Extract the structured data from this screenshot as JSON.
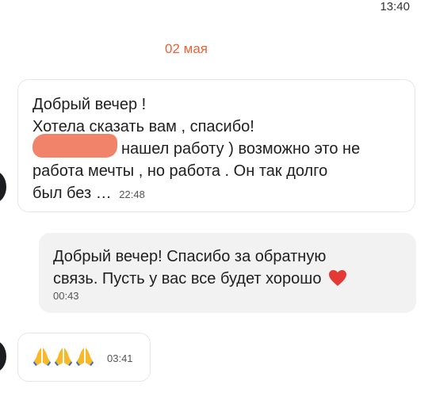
{
  "status_bar": {
    "time": "13:40"
  },
  "date_divider": "02 мая",
  "messages": [
    {
      "direction": "incoming",
      "lines": [
        "Добрый вечер !",
        "Хотела сказать вам , спасибо!",
        "нашел работу ) возможно это не",
        "работа мечты , но работа . Он так долго",
        "был без …"
      ],
      "time": "22:48",
      "redacted": true
    },
    {
      "direction": "outgoing",
      "lines": [
        "Добрый вечер! Спасибо за обратную",
        "связь. Пусть у вас все будет хорошо"
      ],
      "emoji": "heart-icon",
      "time": "00:43"
    },
    {
      "direction": "incoming",
      "emoji": [
        "folded-hands-icon",
        "folded-hands-icon",
        "folded-hands-icon"
      ],
      "time": "03:41"
    }
  ],
  "colors": {
    "accent": "#e8643a",
    "incoming_bubble": "#ffffff",
    "outgoing_bubble": "#f2f2f2",
    "redaction": "#f1836a",
    "heart": "#e53935",
    "emoji": "#f7b928"
  }
}
